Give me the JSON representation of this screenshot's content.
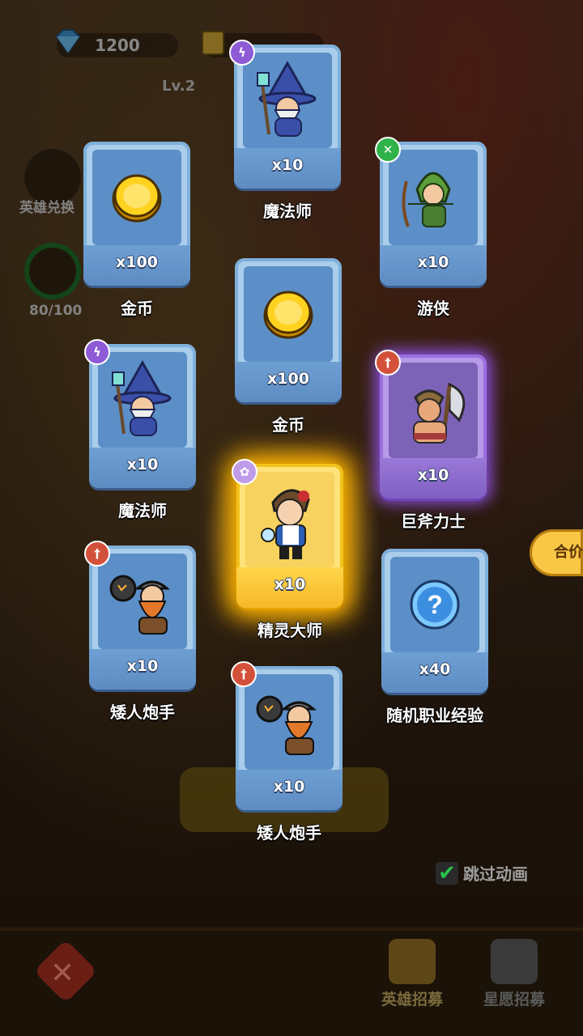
{
  "hud": {
    "diamonds": "1200",
    "level": "Lv.2"
  },
  "left_menu": {
    "hero_exchange": "英雄兑换",
    "progress": "80/100"
  },
  "cards": [
    {
      "name": "魔法师",
      "count": "x10",
      "rarity": "purple-badge",
      "art": "wizard"
    },
    {
      "name": "金币",
      "count": "x100",
      "rarity": "none",
      "art": "gold-coin"
    },
    {
      "name": "游侠",
      "count": "x10",
      "rarity": "green-badge",
      "art": "ranger"
    },
    {
      "name": "金币",
      "count": "x100",
      "rarity": "none",
      "art": "gold-coin"
    },
    {
      "name": "魔法师",
      "count": "x10",
      "rarity": "purple-badge",
      "art": "wizard"
    },
    {
      "name": "巨斧力士",
      "count": "x10",
      "rarity": "epic-purple",
      "art": "axe-warrior"
    },
    {
      "name": "精灵大师",
      "count": "x10",
      "rarity": "legendary-gold",
      "art": "spirit-master"
    },
    {
      "name": "矮人炮手",
      "count": "x10",
      "rarity": "red-badge",
      "art": "dwarf-gunner"
    },
    {
      "name": "随机职业经验",
      "count": "x40",
      "rarity": "none",
      "art": "question-orb"
    },
    {
      "name": "矮人炮手",
      "count": "x10",
      "rarity": "red-badge",
      "art": "dwarf-gunner"
    }
  ],
  "merge_button": "合价",
  "skip_animation": {
    "label": "跳过动画",
    "checked": true
  },
  "bottom_tabs": [
    {
      "label": "英雄招募"
    },
    {
      "label": "星愿招募"
    }
  ],
  "colors": {
    "card_blue": "#a9cdea",
    "card_purple": "#b79ae8",
    "card_gold": "#ffe27a",
    "badge_purple": "#8e5ad6",
    "badge_green": "#2fb24a",
    "badge_red": "#d3513a"
  }
}
